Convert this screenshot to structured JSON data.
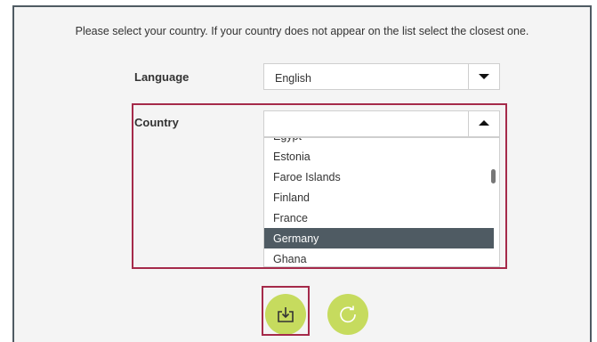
{
  "instruction": "Please select your country. If your country does not appear on the list select the closest one.",
  "language": {
    "label": "Language",
    "value": "English"
  },
  "country": {
    "label": "Country",
    "value": "",
    "options": [
      "Egypt",
      "Estonia",
      "Faroe Islands",
      "Finland",
      "France",
      "Germany",
      "Ghana"
    ],
    "selected": "Germany"
  },
  "icons": {
    "language_toggle": "caret-down-icon",
    "country_toggle": "caret-up-icon",
    "save": "download-icon",
    "reset": "refresh-icon"
  },
  "colors": {
    "accent": "#c6db5e",
    "selected_row": "#4f5b63",
    "highlight": "#a52a4a"
  }
}
